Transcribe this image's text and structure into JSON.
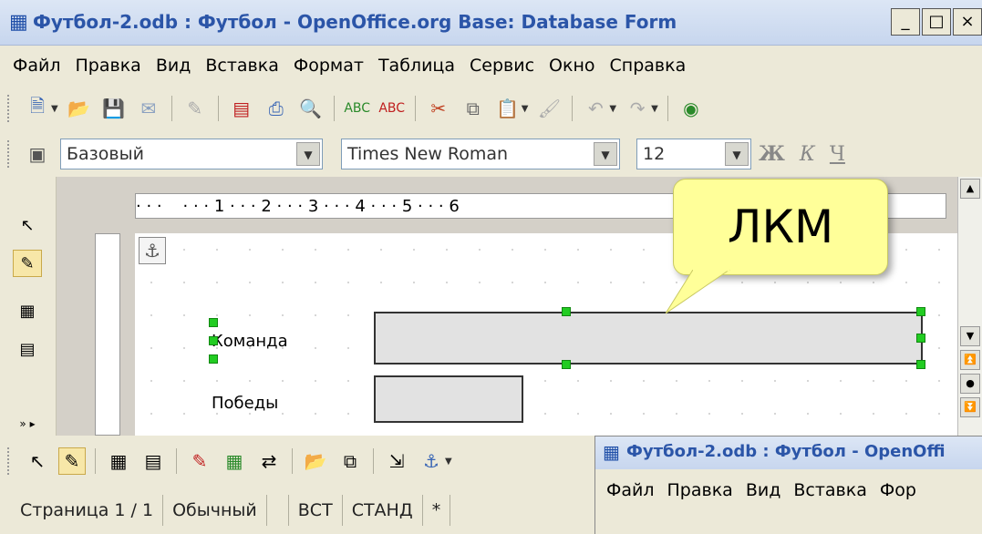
{
  "window": {
    "title": "Футбол-2.odb : Футбол - OpenOffice.org Base: Database Form",
    "controls": [
      "_",
      "□",
      "×"
    ]
  },
  "menu": [
    "Файл",
    "Правка",
    "Вид",
    "Вставка",
    "Формат",
    "Таблица",
    "Сервис",
    "Окно",
    "Справка"
  ],
  "formatting": {
    "style": "Базовый",
    "font": "Times New Roman",
    "size": "12",
    "bold": "Ж",
    "italic": "К",
    "underline": "Ч"
  },
  "ruler": {
    "text": "· · ·    · · · 1 · · · 2 · · · 3 · · · 4 · · · 5 · · · 6"
  },
  "form": {
    "label1": "Команда",
    "label2": "Победы"
  },
  "callout": {
    "text": "ЛКМ",
    "color": "#ffff99"
  },
  "status": {
    "page": "Страница  1 / 1",
    "style": "Обычный",
    "insert": "ВСТ",
    "mode": "СТАНД",
    "modified": "*"
  },
  "second_window": {
    "title": "Футбол-2.odb : Футбол - OpenOffi",
    "menu": [
      "Файл",
      "Правка",
      "Вид",
      "Вставка",
      "Фор"
    ]
  },
  "icons": {
    "toolbar1": [
      "new-document-icon",
      "open-folder-icon",
      "save-icon",
      "email-icon",
      "edit-file-icon",
      "export-pdf-icon",
      "print-icon",
      "page-preview-icon",
      "spellcheck-icon",
      "autospellcheck-icon",
      "cut-icon",
      "copy-icon",
      "paste-icon",
      "clone-format-icon",
      "undo-icon",
      "redo-icon",
      "navigator-icon"
    ],
    "colors": {
      "handle": "#22cc22",
      "title": "#2b55a8"
    }
  }
}
